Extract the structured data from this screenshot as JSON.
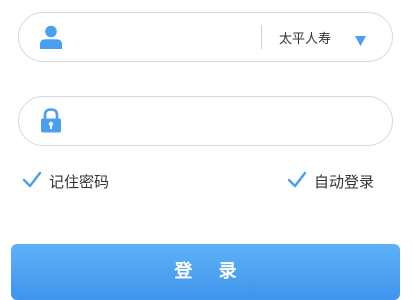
{
  "login_form": {
    "username_field": {
      "value": "",
      "placeholder": ""
    },
    "company_select": {
      "selected_value": "太平人寿"
    },
    "password_field": {
      "value": "",
      "placeholder": ""
    },
    "remember_password": {
      "label": "记住密码",
      "checked": true
    },
    "auto_login": {
      "label": "自动登录",
      "checked": true
    },
    "login_button_label": "登 录"
  },
  "icons": {
    "username": "user-icon",
    "password": "lock-icon",
    "dropdown": "triangle-down-icon",
    "checkbox": "checkmark-icon"
  },
  "colors": {
    "accent_blue": "#4a9ff0",
    "button_gradient_top": "#5fb1f6",
    "button_gradient_bottom": "#3f94ec",
    "field_border": "#d9d9d9",
    "text": "#333333"
  }
}
